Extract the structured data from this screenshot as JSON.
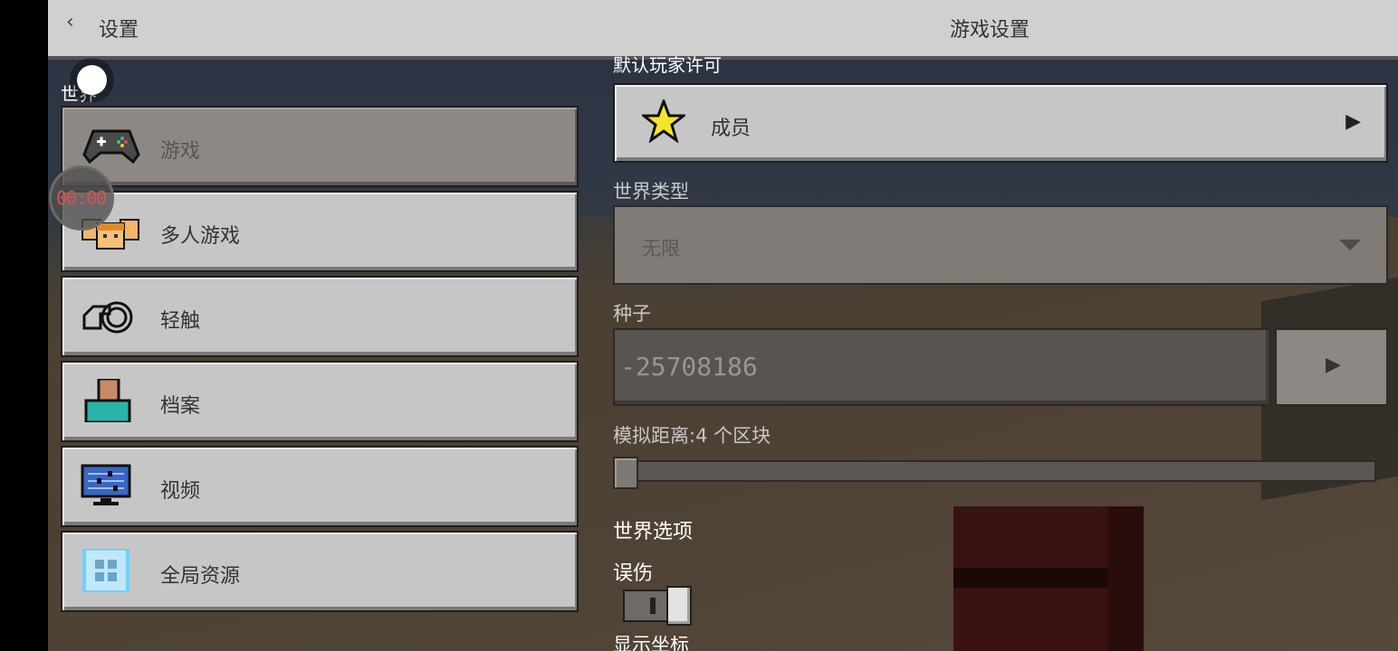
{
  "header": {
    "back_label": "设置",
    "title": "游戏设置"
  },
  "recorder": {
    "timer": "00:00"
  },
  "sidebar": {
    "section_title": "世界",
    "items": [
      {
        "label": "游戏",
        "icon": "gamepad-icon",
        "active": true
      },
      {
        "label": "多人游戏",
        "icon": "multiplayer-icon",
        "active": false
      },
      {
        "label": "轻触",
        "icon": "touch-icon",
        "active": false
      },
      {
        "label": "档案",
        "icon": "profile-icon",
        "active": false
      },
      {
        "label": "视频",
        "icon": "video-settings-icon",
        "active": false
      },
      {
        "label": "全局资源",
        "icon": "global-resources-icon",
        "active": false
      }
    ]
  },
  "settings": {
    "permission_header": "默认玩家许可",
    "permission_value": "成员",
    "world_type_label": "世界类型",
    "world_type_value": "无限",
    "seed_label": "种子",
    "seed_value": "-25708186",
    "sim_distance_label": "模拟距离:4 个区块",
    "sim_distance_level": 0,
    "world_options_title": "世界选项",
    "friendly_fire_label": "误伤",
    "friendly_fire_on": true,
    "next_label_clipped": "显示坐标"
  },
  "colors": {
    "button_face": "#c6c6c6",
    "button_active": "#8d8883",
    "recorder_text": "#e05050"
  }
}
